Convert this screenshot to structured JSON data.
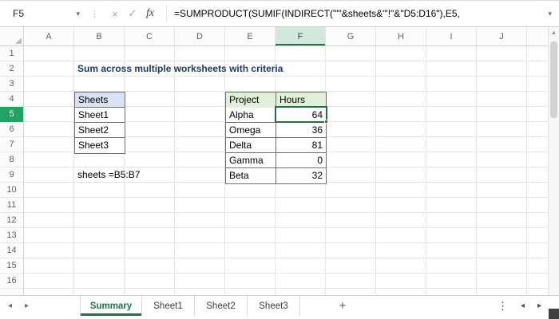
{
  "formula_bar": {
    "cell_reference": "F5",
    "formula": "=SUMPRODUCT(SUMIF(INDIRECT(\"'\"&sheets&\"'!\"&\"D5:D16\"),E5,"
  },
  "icons": {
    "name_box_chevron": "▾",
    "cancel": "×",
    "enter": "✓",
    "fx": "fx",
    "grip": "⋮",
    "formula_expand": "▾",
    "scroll_up": "▲",
    "tab_nav_left": "◂",
    "tab_nav_right": "▸",
    "add_sheet": "+",
    "tab_menu": "⋮",
    "hscroll_left": "◂",
    "hscroll_right": "▸"
  },
  "grid": {
    "column_headers": [
      "A",
      "B",
      "C",
      "D",
      "E",
      "F",
      "G",
      "H",
      "I",
      "J"
    ],
    "row_headers": [
      "1",
      "2",
      "3",
      "4",
      "5",
      "6",
      "7",
      "8",
      "9",
      "10",
      "11",
      "12",
      "13",
      "14",
      "15",
      "16"
    ],
    "selected": {
      "cell": "F5",
      "column": "F",
      "row": "5"
    },
    "content": {
      "title": "Sum across multiple worksheets with criteria",
      "sheets_table": {
        "header": "Sheets",
        "rows": [
          "Sheet1",
          "Sheet2",
          "Sheet3"
        ]
      },
      "named_range_label": "sheets =B5:B7",
      "project_table": {
        "project_header": "Project",
        "hours_header": "Hours",
        "rows": [
          {
            "project": "Alpha",
            "hours": "64"
          },
          {
            "project": "Omega",
            "hours": "36"
          },
          {
            "project": "Delta",
            "hours": "81"
          },
          {
            "project": "Gamma",
            "hours": "0"
          },
          {
            "project": "Beta",
            "hours": "32"
          }
        ]
      }
    }
  },
  "sheet_tabs": {
    "active": "Summary",
    "others": [
      "Sheet1",
      "Sheet2",
      "Sheet3"
    ]
  },
  "colors": {
    "selection_green": "#217346",
    "row_header_selected": "#21A366",
    "col_header_selected_bg": "#D2E8DC",
    "blue_fill": "#D9E1F2",
    "green_fill": "#E2EFDA",
    "title_text": "#1F3864"
  }
}
